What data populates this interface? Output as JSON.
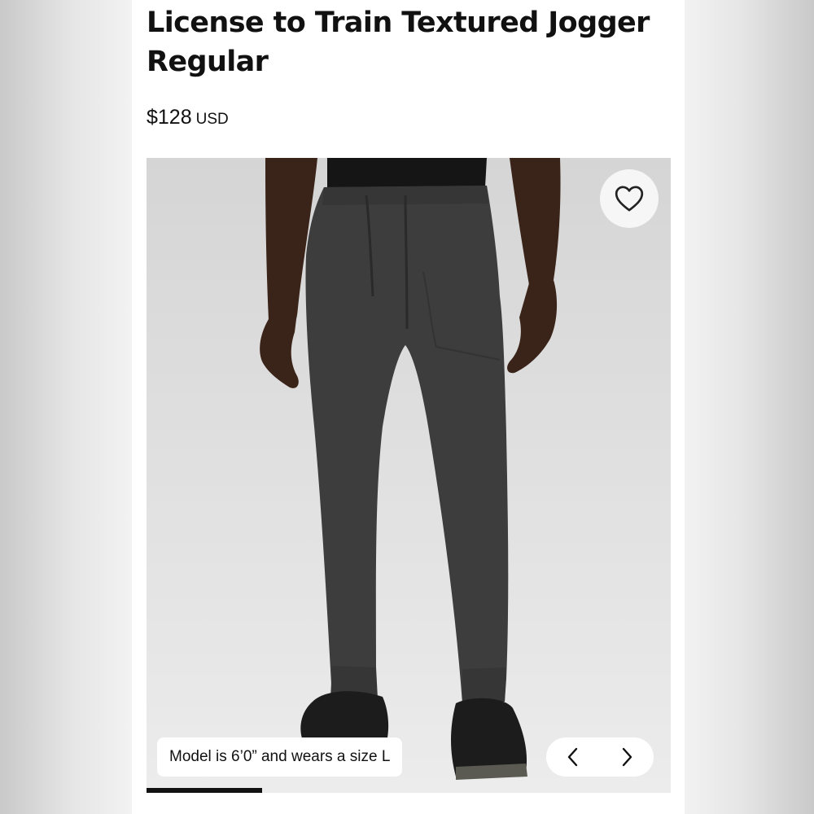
{
  "product": {
    "title_line1": "License to Train Textured Jogger",
    "title_line2": "Regular",
    "price": "$128",
    "currency": "USD"
  },
  "gallery": {
    "image_alt": "Model wearing dark grey textured jogger pants",
    "caption": "Model is 6’0” and wears a size L",
    "favorite_icon": "heart-outline-icon",
    "prev_icon": "chevron-left-icon",
    "next_icon": "chevron-right-icon",
    "progress_fraction": 0.22
  },
  "colors": {
    "pants": "#3f3f3f",
    "background": "#dedede",
    "text": "#111111"
  }
}
